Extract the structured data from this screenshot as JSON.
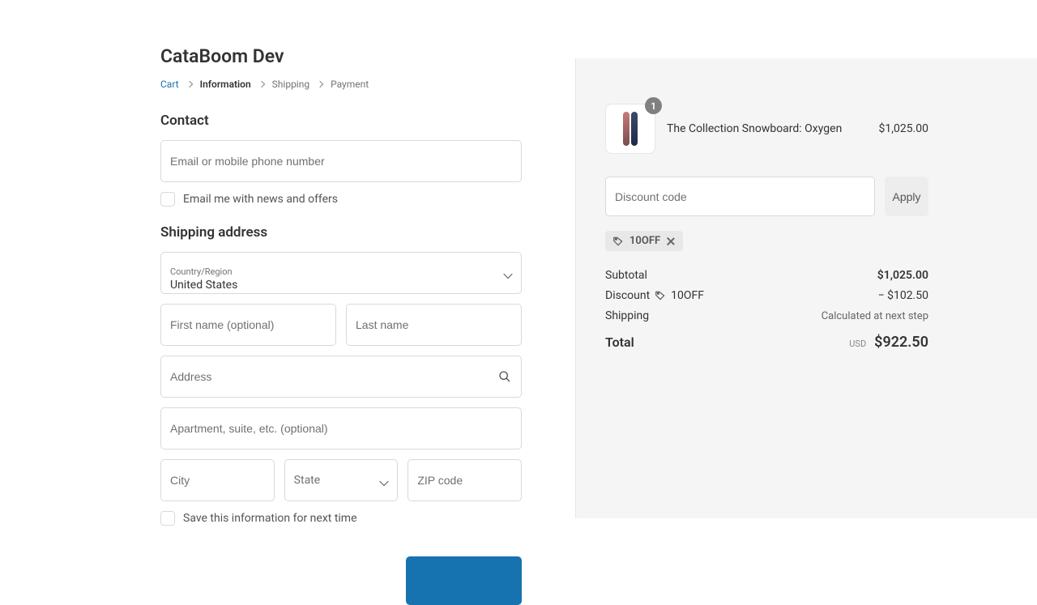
{
  "store_name": "CataBoom Dev",
  "breadcrumb": {
    "cart": "Cart",
    "information": "Information",
    "shipping": "Shipping",
    "payment": "Payment"
  },
  "contact": {
    "heading": "Contact",
    "email_placeholder": "Email or mobile phone number",
    "news_offers_label": "Email me with news and offers"
  },
  "shipping": {
    "heading": "Shipping address",
    "country_label": "Country/Region",
    "country_value": "United States",
    "first_name_placeholder": "First name (optional)",
    "last_name_placeholder": "Last name",
    "address_placeholder": "Address",
    "apartment_placeholder": "Apartment, suite, etc. (optional)",
    "city_placeholder": "City",
    "state_placeholder": "State",
    "zip_placeholder": "ZIP code",
    "save_info_label": "Save this information for next time"
  },
  "product": {
    "name": "The Collection Snowboard: Oxygen",
    "price": "$1,025.00",
    "quantity": "1"
  },
  "discount": {
    "placeholder": "Discount code",
    "apply_label": "Apply",
    "tag_code": "10OFF"
  },
  "summary": {
    "subtotal_label": "Subtotal",
    "subtotal_value": "$1,025.00",
    "discount_label": "Discount",
    "discount_code": "10OFF",
    "discount_value": "− $102.50",
    "shipping_label": "Shipping",
    "shipping_value": "Calculated at next step",
    "total_label": "Total",
    "currency": "USD",
    "total_value": "$922.50"
  }
}
